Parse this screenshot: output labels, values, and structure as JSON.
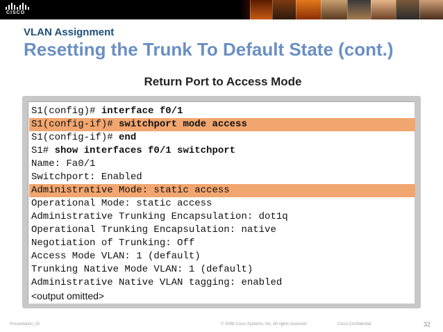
{
  "brand": {
    "logo_text": "CISCO"
  },
  "header": {
    "section_title": "VLAN Assignment",
    "main_title": "Resetting the Trunk To Default State (cont.)"
  },
  "figure": {
    "title": "Return Port to Access Mode"
  },
  "terminal": {
    "lines": [
      {
        "prompt": "S1(config)# ",
        "command": "interface f0/1",
        "highlight": false
      },
      {
        "prompt": "S1(config-if)# ",
        "command": "switchport mode access",
        "highlight": true
      },
      {
        "prompt": "S1(config-if)# ",
        "command": "end",
        "highlight": false
      },
      {
        "prompt": "S1# ",
        "command": "show interfaces f0/1 switchport",
        "highlight": false
      },
      {
        "prompt": "Name: Fa0/1",
        "command": "",
        "highlight": false
      },
      {
        "prompt": "Switchport: Enabled",
        "command": "",
        "highlight": false
      },
      {
        "prompt": "Administrative Mode: static access",
        "command": "",
        "highlight": true
      },
      {
        "prompt": "Operational Mode: static access",
        "command": "",
        "highlight": false
      },
      {
        "prompt": "Administrative Trunking Encapsulation: dot1q",
        "command": "",
        "highlight": false
      },
      {
        "prompt": "Operational Trunking Encapsulation: native",
        "command": "",
        "highlight": false
      },
      {
        "prompt": "Negotiation of Trunking: Off",
        "command": "",
        "highlight": false
      },
      {
        "prompt": "Access Mode VLAN: 1 (default)",
        "command": "",
        "highlight": false
      },
      {
        "prompt": "Trunking Native Mode VLAN: 1 (default)",
        "command": "",
        "highlight": false
      },
      {
        "prompt": "Administrative Native VLAN tagging: enabled",
        "command": "",
        "highlight": false
      },
      {
        "prompt": "<output omitted>",
        "command": "",
        "highlight": false
      }
    ]
  },
  "footer": {
    "left": "Presentation_ID",
    "center": "© 2008 Cisco Systems, Inc. All rights reserved.",
    "right": "Cisco Confidential",
    "page_number": "32"
  },
  "colors": {
    "section_title": "#1f4e79",
    "main_title": "#6a8fc2",
    "highlight": "#f2a66f",
    "banner_bg": "#000000"
  }
}
